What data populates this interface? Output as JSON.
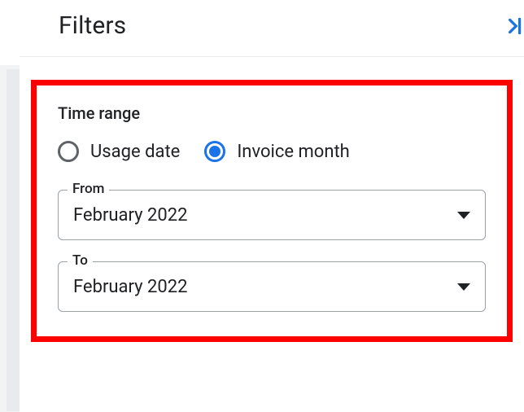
{
  "header": {
    "title": "Filters"
  },
  "timeRange": {
    "section_title": "Time range",
    "options": {
      "usage_date": {
        "label": "Usage date",
        "selected": false
      },
      "invoice_month": {
        "label": "Invoice month",
        "selected": true
      }
    },
    "from": {
      "label": "From",
      "value": "February 2022"
    },
    "to": {
      "label": "To",
      "value": "February 2022"
    }
  }
}
